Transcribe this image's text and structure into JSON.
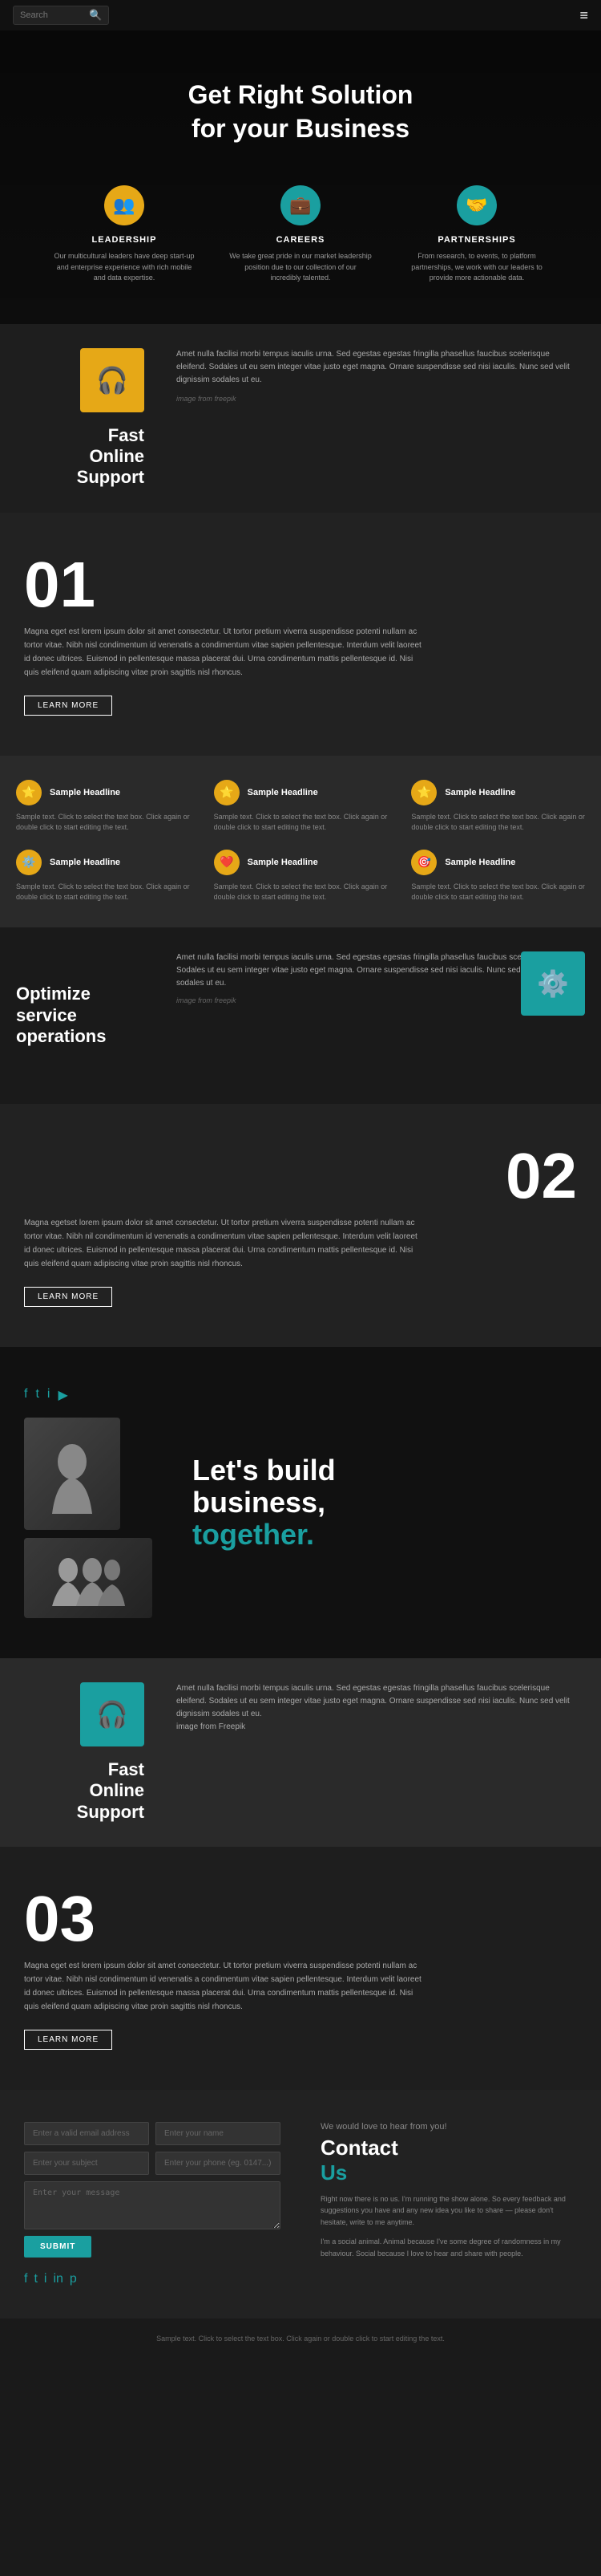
{
  "nav": {
    "search_placeholder": "Search",
    "menu_icon": "≡"
  },
  "hero": {
    "title": "Get Right Solution\nfor your Business",
    "cards": [
      {
        "icon": "👥",
        "icon_bg": "yellow",
        "label": "LEADERSHIP",
        "text": "Our multicultural leaders have deep start-up and enterprise experience with rich mobile and data expertise."
      },
      {
        "icon": "💼",
        "icon_bg": "teal",
        "label": "CAREERS",
        "text": "We take great pride in our market leadership position due to our collection of our incredibly talented."
      },
      {
        "icon": "🤝",
        "icon_bg": "teal",
        "label": "PARTNERSHIPS",
        "text": "From research, to events, to platform partnerships, we work with our leaders to provide more actionable data."
      }
    ]
  },
  "support_section": {
    "icon": "🎧",
    "title": "Fast\nOnline\nSupport",
    "body": "Amet nulla facilisi morbi tempus iaculis urna. Sed egestas egestas fringilla phasellus faucibus scelerisque eleifend. Sodales ut eu sem integer vitae justo eget magna. Ornare suspendisse sed nisi iaculis. Nunc sed velit dignissim sodales ut eu.",
    "image_credit": "image from freepik"
  },
  "section_01": {
    "number": "01",
    "body": "Magna eget est lorem ipsum dolor sit amet consectetur. Ut tortor pretium viverra suspendisse potenti nullam ac tortor vitae. Nibh nisl condimentum id venenatis a condimentum vitae sapien pellentesque. Interdum velit laoreet id donec ultrices. Euismod in pellentesque massa placerat dui. Urna condimentum mattis pellentesque id. Nisi quis eleifend quam adipiscing vitae proin sagittis nisl rhoncus.",
    "learn_more": "learn more"
  },
  "grid_section": {
    "items": [
      {
        "icon": "⭐",
        "icon_bg": "yellow",
        "title": "Sample Headline",
        "text": "Sample text. Click to select the text box. Click again or double click to start editing the text."
      },
      {
        "icon": "⭐",
        "icon_bg": "yellow",
        "title": "Sample Headline",
        "text": "Sample text. Click to select the text box. Click again or double click to start editing the text."
      },
      {
        "icon": "⭐",
        "icon_bg": "yellow",
        "title": "Sample Headline",
        "text": "Sample text. Click to select the text box. Click again or double click to start editing the text."
      },
      {
        "icon": "⚙️",
        "icon_bg": "yellow",
        "title": "Sample Headline",
        "text": "Sample text. Click to select the text box. Click again or double click to start editing the text."
      },
      {
        "icon": "❤️",
        "icon_bg": "yellow",
        "title": "Sample Headline",
        "text": "Sample text. Click to select the text box. Click again or double click to start editing the text."
      },
      {
        "icon": "🎯",
        "icon_bg": "yellow",
        "title": "Sample Headline",
        "text": "Sample text. Click to select the text box. Click again or double click to start editing the text."
      }
    ]
  },
  "optimize_section": {
    "title": "Optimize\nservice\noperations",
    "icon": "⚙️",
    "body": "Amet nulla facilisi morbi tempus iaculis urna. Sed egestas egestas fringilla phasellus faucibus scelerisque eleifend. Sodales ut eu sem integer vitae justo eget magna. Ornare suspendisse sed nisi iaculis. Nunc sed velit dignissim sodales ut eu.",
    "image_credit": "image from freepik"
  },
  "section_02": {
    "number": "02",
    "body": "Magna egetset lorem ipsum dolor sit amet consectetur. Ut tortor pretium viverra suspendisse potenti nullam ac tortor vitae. Nibh nil condimentum id venenatis a condimentum vitae sapien pellentesque. Interdum velit laoreet id donec ultrices. Euismod in pellentesque massa placerat dui. Urna condimentum mattis pellentesque id. Nisi quis eleifend quam adipiscing vitae proin sagittis nisl rhoncus.",
    "learn_more": "learn more"
  },
  "build_section": {
    "social_icons": [
      "f",
      "t",
      "i",
      "▶"
    ],
    "headline_line1": "Let's build",
    "headline_line2": "business,",
    "headline_line3": "together."
  },
  "support2_section": {
    "icon": "🎧",
    "title": "Fast\nOnline\nSupport",
    "body": "Amet nulla facilisi morbi tempus iaculis urna. Sed egestas egestas fringilla phasellus faucibus scelerisque eleifend. Sodales ut eu sem integer vitae justo eget magna. Ornare suspendisse sed nisi iaculis. Nunc sed velit dignissim sodales ut eu.",
    "image_credit": "image from Freepik"
  },
  "section_03": {
    "number": "03",
    "body": "Magna eget est lorem ipsum dolor sit amet consectetur. Ut tortor pretium viverra suspendisse potenti nullam ac tortor vitae. Nibh nisl condimentum id venenatis a condimentum vitae sapien pellentesque. Interdum velit laoreet id donec ultrices. Euismod in pellentesque massa placerat dui. Urna condimentum mattis pellentesque id. Nisi quis eleifend quam adipiscing vitae proin sagittis nisl rhoncus.",
    "learn_more": "learn more"
  },
  "contact_section": {
    "subtitle": "We would love to hear from you!",
    "title": "Contact",
    "title2": "Us",
    "body": "Right now there is no us. I'm running the show alone. So every feedback and suggestions you have and any new idea you like to share — please don't hesitate, write to me anytime.",
    "body2": "I'm a social animal. Animal because I've some degree of randomness in my behaviour. Social because I love to hear and share with people.",
    "form": {
      "email_placeholder": "Enter a valid email address",
      "name_placeholder": "Enter your name",
      "subject_placeholder": "Enter your subject",
      "phone_placeholder": "Enter your phone (eg. 0147...)",
      "message_placeholder": "Enter your message",
      "submit_label": "SUBMIT"
    },
    "social_icons": [
      "f",
      "t",
      "i",
      "in",
      "p"
    ]
  },
  "footer": {
    "sample_text": "Sample text. Click to select the text box. Click again or double click to start editing the text."
  }
}
